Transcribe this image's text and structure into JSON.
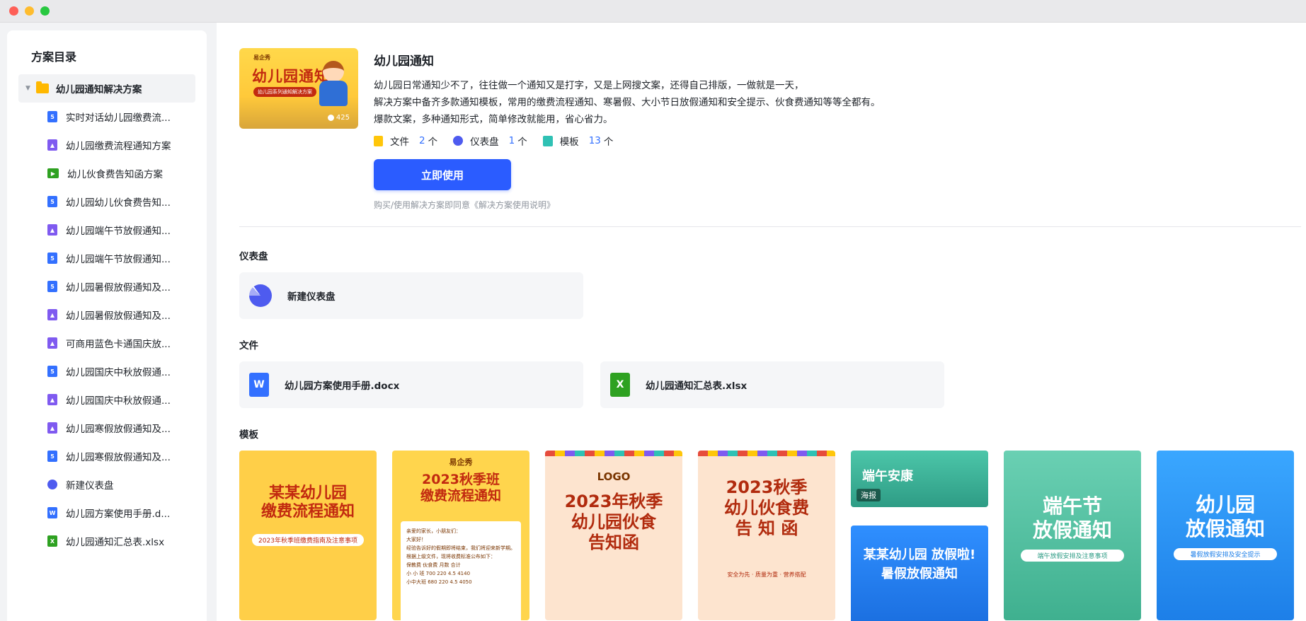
{
  "sidebar": {
    "title": "方案目录",
    "folder": "幼儿园通知解决方案",
    "items": [
      {
        "label": "实时对话幼儿园缴费流...",
        "icon": "doc"
      },
      {
        "label": "幼儿园缴费流程通知方案",
        "icon": "img"
      },
      {
        "label": "幼儿伙食费告知函方案",
        "icon": "video"
      },
      {
        "label": "幼儿园幼儿伙食费告知...",
        "icon": "doc"
      },
      {
        "label": "幼儿园端午节放假通知...",
        "icon": "img"
      },
      {
        "label": "幼儿园端午节放假通知...",
        "icon": "doc"
      },
      {
        "label": "幼儿园暑假放假通知及...",
        "icon": "doc"
      },
      {
        "label": "幼儿园暑假放假通知及...",
        "icon": "img"
      },
      {
        "label": "可商用蓝色卡通国庆放...",
        "icon": "img"
      },
      {
        "label": "幼儿园国庆中秋放假通...",
        "icon": "doc"
      },
      {
        "label": "幼儿园国庆中秋放假通...",
        "icon": "img"
      },
      {
        "label": "幼儿园寒假放假通知及...",
        "icon": "img"
      },
      {
        "label": "幼儿园寒假放假通知及...",
        "icon": "doc"
      },
      {
        "label": "新建仪表盘",
        "icon": "dash"
      },
      {
        "label": "幼儿园方案使用手册.d...",
        "icon": "word"
      },
      {
        "label": "幼儿园通知汇总表.xlsx",
        "icon": "xls"
      }
    ]
  },
  "hero": {
    "cover": {
      "brand": "易企秀",
      "title": "幼儿园通知",
      "subtitle": "幼儿园系列通知解决方案",
      "views": "425"
    },
    "title": "幼儿园通知",
    "desc": [
      "幼儿园日常通知少不了，往往做一个通知又是打字，又是上网搜文案，还得自己排版，一做就是一天，",
      "解决方案中备齐多款通知模板，常用的缴费流程通知、寒暑假、大小节日放假通知和安全提示、伙食费通知等等全都有。",
      "爆款文案，多种通知形式，简单修改就能用，省心省力。"
    ],
    "stats": {
      "file_label": "文件",
      "file_count": "2",
      "dash_label": "仪表盘",
      "dash_count": "1",
      "tpl_label": "模板",
      "tpl_count": "13",
      "unit": "个"
    },
    "use_button": "立即使用",
    "agreement": "购买/使用解决方案即同意《解决方案使用说明》"
  },
  "sections": {
    "dashboard": {
      "title": "仪表盘",
      "items": [
        "新建仪表盘"
      ]
    },
    "files": {
      "title": "文件",
      "items": [
        "幼儿园方案使用手册.docx",
        "幼儿园通知汇总表.xlsx"
      ]
    },
    "templates": {
      "title": "模板",
      "t1": {
        "title": "某某幼儿园\n缴费流程通知",
        "sub": "2023年秋季班缴费指南及注意事项"
      },
      "t2": {
        "brand": "易企秀",
        "title": "2023秋季班\n缴费流程通知",
        "paper": "亲爱的家长，小朋友们：\n大家好！\n经验告诉好的假期即将结束，我们将迎来新学期。根据上级文件，现将收费标准公布如下：\n保教费  伙食费  月数  合计\n小 小 班  700  220  4.5  4140\n小中大班  680  220  4.5  4050"
      },
      "t3": {
        "logo": "LOGO",
        "title": "2023年秋季\n幼儿园伙食\n告知函"
      },
      "t4": {
        "title": "2023秋季\n幼儿伙食费\n告 知 函",
        "sub": "安全为先 · 质量为重 · 营养搭配"
      },
      "t5a": {
        "title": "端午安康",
        "badge": "海报"
      },
      "t5b": {
        "title": "某某幼儿园 放假啦!\n暑假放假通知"
      },
      "t6": {
        "title": "端午节\n放假通知",
        "sub": "端午放假安排及注意事项"
      },
      "t7": {
        "title": "幼儿园\n放假通知",
        "sub": "暑假放假安排及安全提示"
      }
    }
  }
}
